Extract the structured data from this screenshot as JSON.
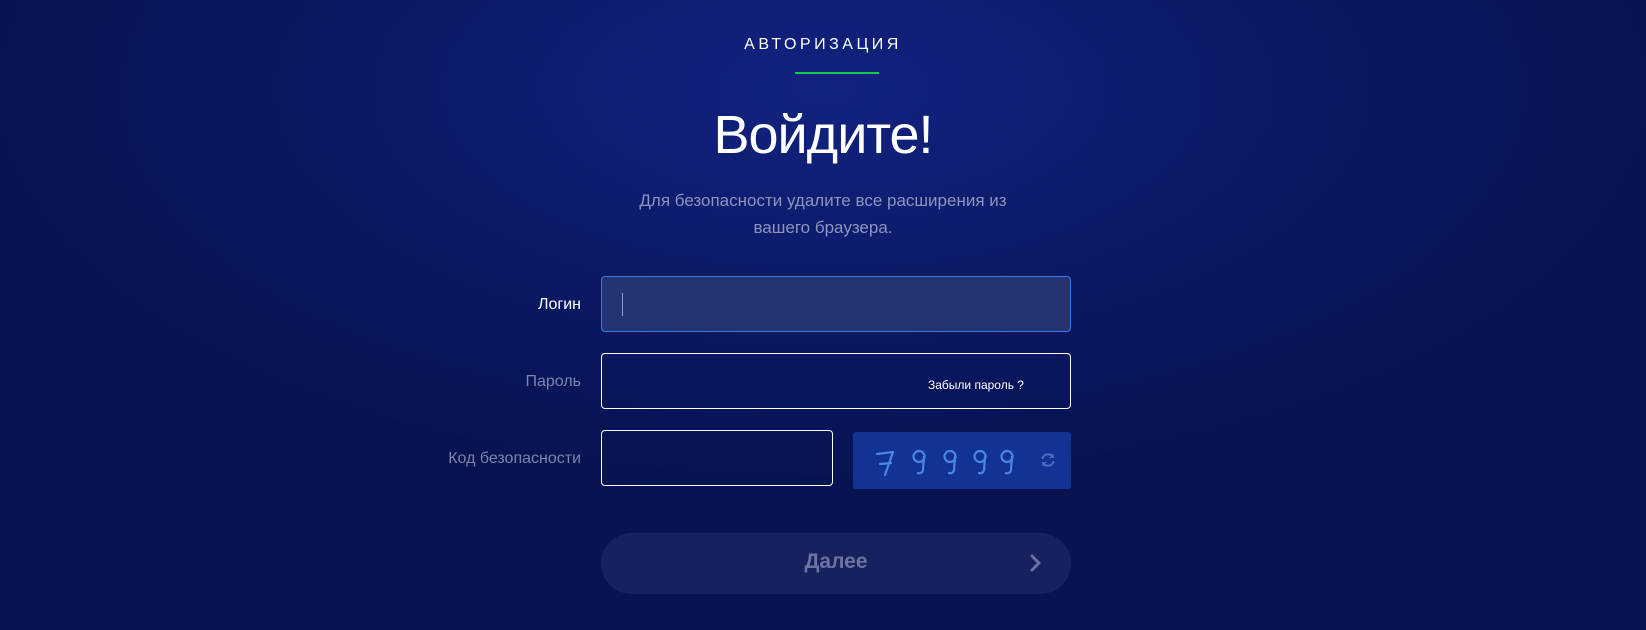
{
  "header": {
    "section_label": "АВТОРИЗАЦИЯ",
    "title": "Войдите!",
    "subtitle": "Для безопасности удалите все расширения из вашего браузера."
  },
  "form": {
    "login": {
      "label": "Логин",
      "value": "",
      "placeholder": ""
    },
    "password": {
      "label": "Пароль",
      "value": "",
      "forgot_link": "Забыли пароль ?"
    },
    "security_code": {
      "label": "Код безопасности",
      "value": "",
      "captcha_text": "79999"
    },
    "submit_label": "Далее"
  },
  "colors": {
    "background": "#0b1762",
    "accent_underline": "#12c950",
    "focus_border": "#3a78e6",
    "captcha_bg": "#133394",
    "button_bg": "#16215e"
  },
  "icons": {
    "refresh": "refresh-icon",
    "submit_arrow": "chevron-right-icon"
  }
}
